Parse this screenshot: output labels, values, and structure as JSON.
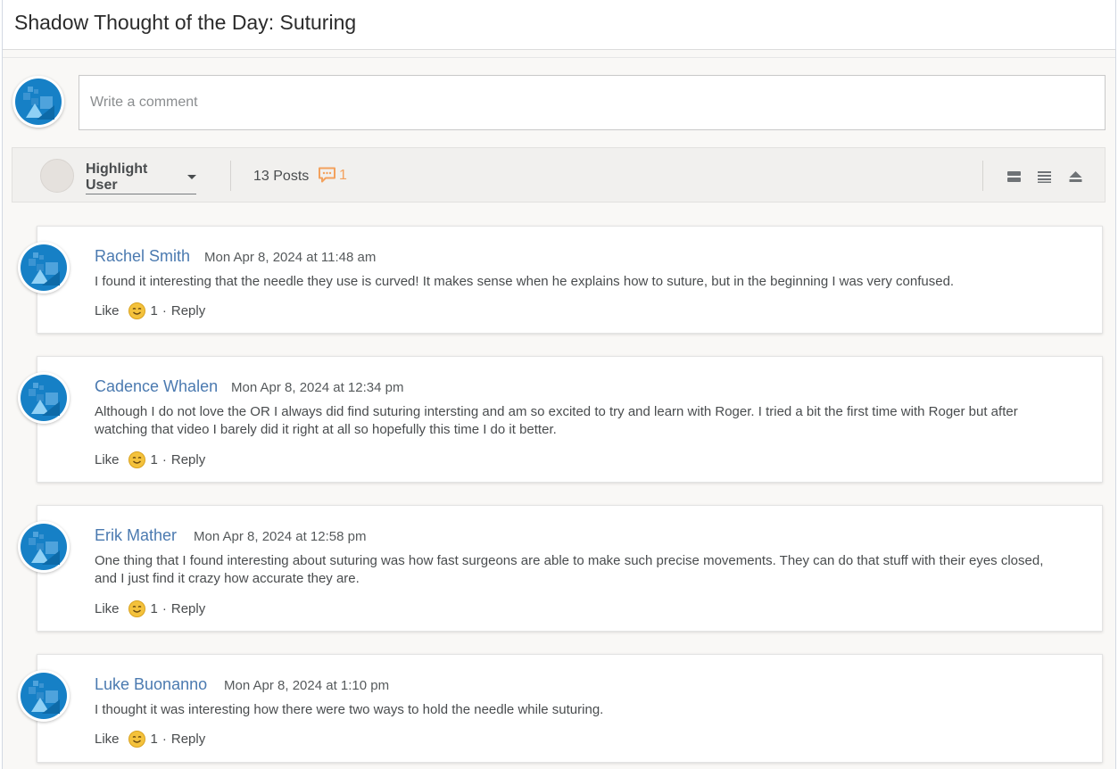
{
  "page": {
    "title": "Shadow Thought of the Day: Suturing"
  },
  "composer": {
    "placeholder": "Write a comment"
  },
  "toolbar": {
    "highlight_user_label": "Highlight User",
    "posts_count": "13 Posts",
    "unread_count": "1",
    "view_icons": [
      "condensed-view-icon",
      "list-view-icon",
      "collapse-view-icon"
    ]
  },
  "colors": {
    "accent_link": "#4b7ab0",
    "unread_orange": "#f3a15d",
    "avatar_blue": "#1680c6",
    "emoji_yellow": "#f4c23c"
  },
  "posts": [
    {
      "author": "Rachel Smith",
      "date": "Mon Apr 8, 2024 at 11:48 am",
      "body": "I found it interesting that the needle they use is curved! It makes sense when he explains how to suture, but in the beginning I was very confused.",
      "like_label": "Like",
      "reaction_count": "1",
      "reply_label": "Reply"
    },
    {
      "author": "Cadence Whalen",
      "date": "Mon Apr 8, 2024 at 12:34 pm",
      "body": "Although I do not love the OR I always did find suturing intersting and am so excited to try and learn with Roger. I tried a bit the first time with Roger but after watching that video I barely did it right at all so hopefully this time I do it better.",
      "like_label": "Like",
      "reaction_count": "1",
      "reply_label": "Reply"
    },
    {
      "author": "Erik Mather",
      "date": "Mon Apr 8, 2024 at 12:58 pm",
      "body": "One thing that I found interesting about suturing was how fast surgeons are able to make such precise movements. They can do that stuff with their eyes closed, and I just find it crazy how accurate they are.",
      "like_label": "Like",
      "reaction_count": "1",
      "reply_label": "Reply"
    },
    {
      "author": "Luke Buonanno",
      "date": "Mon Apr 8, 2024 at 1:10 pm",
      "body": "I thought it was interesting how there were two ways to hold the needle while suturing.",
      "like_label": "Like",
      "reaction_count": "1",
      "reply_label": "Reply"
    }
  ]
}
